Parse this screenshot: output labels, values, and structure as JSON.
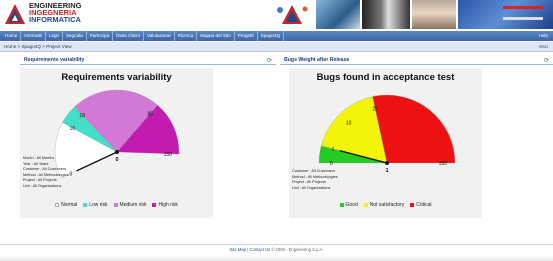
{
  "brand": {
    "line1": "ENGINEERING",
    "line2": "INGEGNERIA",
    "line3": "INFORMATICA"
  },
  "nav": {
    "items": [
      "Home",
      "Internals",
      "Logs",
      "Segnala",
      "Partecipa",
      "Dieta Client",
      "Valutazione",
      "Ricerca",
      "Mappa del Sito",
      "Progetti",
      "Spago4Q"
    ],
    "help": "Help"
  },
  "breadcrumb": "Home > Spago4Q > Project View",
  "logout": "Esci",
  "panels": {
    "left": {
      "title": "Requirements variability"
    },
    "right": {
      "title": "Bugs Weight after Release"
    }
  },
  "footer": {
    "sitemap": "Site Map",
    "separator": "|",
    "contact": "Contact Us",
    "copyright": "© 2009 - Engineering S.p.A."
  },
  "chart_data": [
    {
      "type": "gauge",
      "title": "Requirements variability",
      "min": 0,
      "max": 150,
      "ticks": [
        0,
        10,
        18,
        85,
        150
      ],
      "value": 0,
      "value_label": "0",
      "bands": [
        {
          "name": "Normal",
          "from": 0,
          "to": 10,
          "color": "#ffffff"
        },
        {
          "name": "Low risk",
          "from": 10,
          "to": 18,
          "color": "#40e0c8"
        },
        {
          "name": "Medium risk",
          "from": 18,
          "to": 85,
          "color": "#d278d6"
        },
        {
          "name": "High risk",
          "from": 85,
          "to": 150,
          "color": "#c21bb0"
        }
      ],
      "info": [
        "Month : All Months",
        "Year : All Years",
        "Customer : All Customers",
        "Method : All Methodologies",
        "Project : All Projects",
        "Unit : All Organizations"
      ]
    },
    {
      "type": "gauge",
      "title": "Bugs  found in acceptance test",
      "min": 0,
      "max": 150,
      "ticks": [
        0,
        1,
        10,
        28,
        150
      ],
      "value": 1,
      "value_label": "1",
      "bands": [
        {
          "name": "Good",
          "from": 0,
          "to": 1,
          "color": "#22cc22"
        },
        {
          "name": "Not satisfactory",
          "from": 1,
          "to": 28,
          "color": "#f4f40a"
        },
        {
          "name": "Critical",
          "from": 28,
          "to": 150,
          "color": "#ee1111"
        }
      ],
      "info": [
        "Customer : All Customers",
        "Method : All Methodologies",
        "Project : All Projects",
        "Unit : All Organizations"
      ]
    }
  ]
}
